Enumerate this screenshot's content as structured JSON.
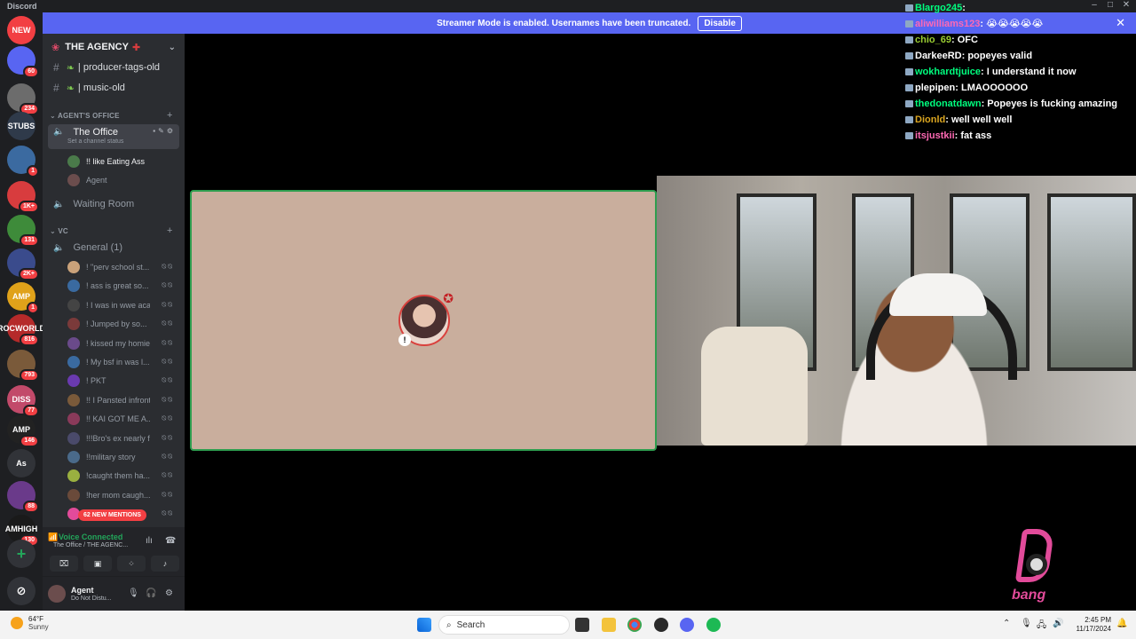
{
  "window": {
    "app_name": "Discord",
    "min": "–",
    "max": "□",
    "close": "✕"
  },
  "banner": {
    "text": "Streamer Mode is enabled. Usernames have been truncated.",
    "button": "Disable",
    "close": "✕"
  },
  "server_rail": [
    {
      "label": "NEW",
      "badge": "",
      "color": "#f23f43"
    },
    {
      "label": "",
      "badge": "60",
      "color": "#5865f2"
    },
    {
      "label": "",
      "badge": "234",
      "color": "#6c6c6c"
    },
    {
      "label": "STUBS",
      "badge": "",
      "color": "#2f3a4a"
    },
    {
      "label": "",
      "badge": "1",
      "color": "#3b6aa0"
    },
    {
      "label": "",
      "badge": "1K+",
      "color": "#d83c3e"
    },
    {
      "label": "",
      "badge": "131",
      "color": "#3e8b3a"
    },
    {
      "label": "",
      "badge": "2K+",
      "color": "#3a4b8c"
    },
    {
      "label": "AMP",
      "badge": "1",
      "color": "#e0a21a"
    },
    {
      "label": "ROCWORLD",
      "badge": "816",
      "color": "#b52a2a"
    },
    {
      "label": "",
      "badge": "793",
      "color": "#7a5a3a"
    },
    {
      "label": "DISS",
      "badge": "77",
      "color": "#c24a6a"
    },
    {
      "label": "AMP",
      "badge": "146",
      "color": "#222"
    },
    {
      "label": "As",
      "badge": "",
      "color": "#313338"
    },
    {
      "label": "",
      "badge": "88",
      "color": "#6a3a8a"
    },
    {
      "label": "AMHIGH",
      "badge": "130",
      "color": "#1a1a1a"
    }
  ],
  "sidebar": {
    "guild_name": "THE AGENCY",
    "channels": [
      "| producer-tags-old",
      "| music-old"
    ],
    "category_office": "AGENT'S OFFICE",
    "office_channel": "The Office",
    "office_status": "Set a channel status",
    "office_users": [
      "!! like Eating Ass",
      "Agent"
    ],
    "waiting_room": "Waiting Room",
    "category_vc": "VC",
    "general_channel": "General (1)",
    "vc_users": [
      "! \"perv school st...",
      "! ass is great so...",
      "! I was in wwe acad...",
      "! Jumped by so...",
      "! kissed my homie",
      "! My bsf in was l...",
      "! PKT",
      "!! I Pansted infront ...",
      "!! KAI GOT ME A...",
      "!!!Bro's ex nearly fu...",
      "!!military story",
      "!caught them ha...",
      "!her mom caugh...",
      ""
    ],
    "new_mentions": "62 NEW MENTIONS",
    "voice_status": "Voice Connected",
    "voice_location": "The Office / THE AGENC...",
    "user_name": "Agent",
    "user_status": "Do Not Distu..."
  },
  "chat": [
    {
      "user": "Blargo245",
      "msg": "",
      "color": "#00ff7f"
    },
    {
      "user": "aliwilliams123",
      "msg": "😭😭😭😭😭",
      "color": "#ff69b4"
    },
    {
      "user": "chio_69",
      "msg": "OFC",
      "color": "#9acd32"
    },
    {
      "user": "DarkeeRD",
      "msg": "popeyes valid",
      "color": "#ffffff"
    },
    {
      "user": "wokhardtjuice",
      "msg": "I understand it now",
      "color": "#00ff7f"
    },
    {
      "user": "plepipen",
      "msg": "LMAOOOOOO",
      "color": "#ffffff"
    },
    {
      "user": "thedonatdawn",
      "msg": "Popeyes is fucking amazing",
      "color": "#00ff7f"
    },
    {
      "user": "Dionld",
      "msg": "well well well",
      "color": "#daa520"
    },
    {
      "user": "itsjustkii",
      "msg": "fat ass",
      "color": "#ff69b4"
    }
  ],
  "overlay_logo": "bang",
  "taskbar": {
    "temp": "64°F",
    "weather": "Sunny",
    "search": "Search",
    "time": "2:45 PM",
    "date": "11/17/2024"
  }
}
